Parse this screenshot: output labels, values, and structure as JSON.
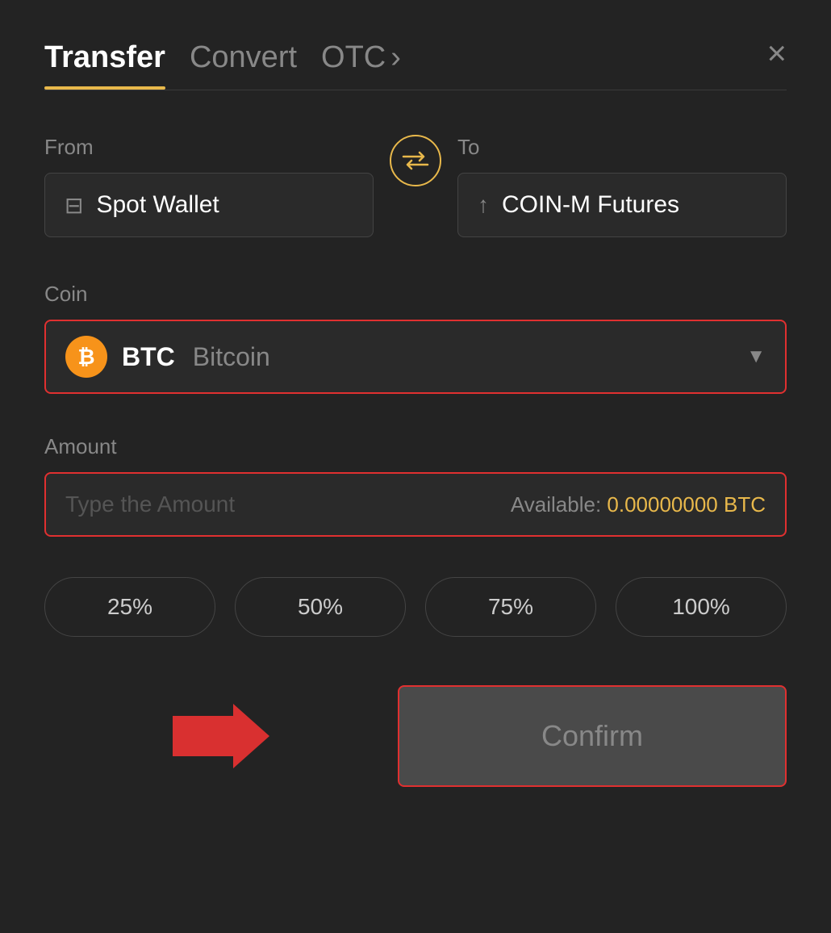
{
  "header": {
    "transfer_label": "Transfer",
    "convert_label": "Convert",
    "otc_label": "OTC",
    "close_icon": "×"
  },
  "from_section": {
    "label": "From",
    "wallet_name": "Spot Wallet"
  },
  "to_section": {
    "label": "To",
    "wallet_name": "COIN-M Futures"
  },
  "coin_section": {
    "label": "Coin",
    "coin_symbol": "BTC",
    "coin_name": "Bitcoin",
    "coin_icon": "₿"
  },
  "amount_section": {
    "label": "Amount",
    "placeholder": "Type the Amount",
    "available_label": "Available:",
    "available_value": "0.00000000 BTC"
  },
  "percentage_buttons": [
    "25%",
    "50%",
    "75%",
    "100%"
  ],
  "confirm_button": {
    "label": "Confirm"
  },
  "colors": {
    "accent_yellow": "#e8b84b",
    "accent_red": "#e03030",
    "bg_dark": "#232323",
    "bg_input": "#2a2a2a"
  }
}
